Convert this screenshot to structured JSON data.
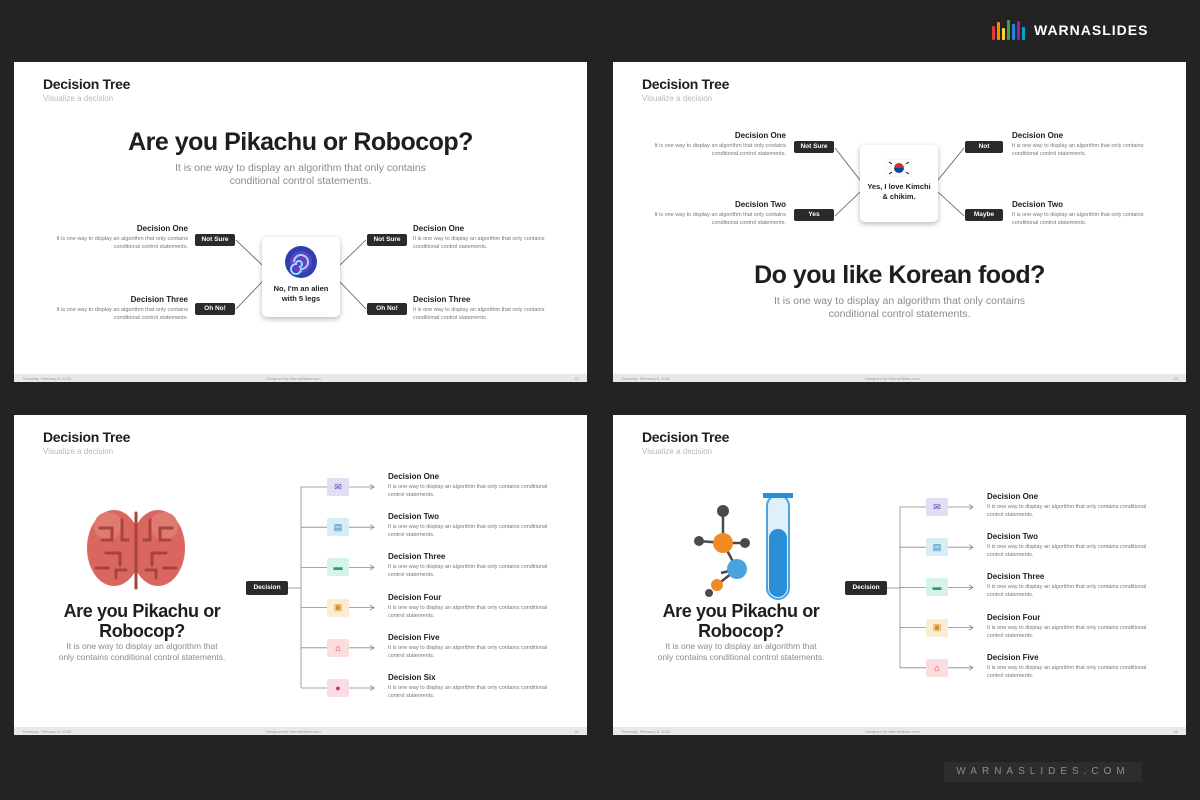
{
  "brand": {
    "name": "WARNASLIDES",
    "bar_colors": [
      "#e53935",
      "#fb8c00",
      "#fdd835",
      "#43a047",
      "#1e88e5",
      "#8e24aa",
      "#00acc1"
    ]
  },
  "watermark": "WARNASLIDES.COM",
  "common": {
    "title": "Decision Tree",
    "subtitle": "Visualize a decision",
    "footer_date": "Thursday, February 6, 2020",
    "footer_design": "Designed by WarnaSlides.com",
    "desc": "It is one way to display an algorithm that only contains conditional control statements."
  },
  "slide1": {
    "question": "Are you Pikachu or Robocop?",
    "description": "It is one way to display an algorithm that only contains conditional control statements.",
    "center_text": "No, I'm an alien with 5 legs",
    "left_top": {
      "title": "Decision One",
      "pill": "Not Sure"
    },
    "left_bottom": {
      "title": "Decision Three",
      "pill": "Oh No!"
    },
    "right_top": {
      "title": "Decision One",
      "pill": "Not Sure"
    },
    "right_bottom": {
      "title": "Decision Three",
      "pill": "Oh No!"
    },
    "page": "42"
  },
  "slide2": {
    "question": "Do you like Korean food?",
    "description": "It is one way to display an algorithm that only contains conditional control statements.",
    "center_text": "Yes, I love Kimchi & chikim.",
    "left_top": {
      "title": "Decision One",
      "pill": "Not Sure"
    },
    "left_bottom": {
      "title": "Decision Two",
      "pill": "Yes"
    },
    "right_top": {
      "title": "Decision One",
      "pill": "Not"
    },
    "right_bottom": {
      "title": "Decision Two",
      "pill": "Maybe"
    },
    "page": "43"
  },
  "slide3": {
    "question_line1": "Are you Pikachu or",
    "question_line2": "Robocop?",
    "description": "It is one way to display an algorithm that only contains conditional control statements.",
    "root": "Decision",
    "items": [
      {
        "title": "Decision One",
        "color": "#e3dcf5",
        "fg": "#5a3fb8"
      },
      {
        "title": "Decision Two",
        "color": "#d6ecf7",
        "fg": "#2a7fb4"
      },
      {
        "title": "Decision Three",
        "color": "#d5f3e7",
        "fg": "#2e9c6e"
      },
      {
        "title": "Decision Four",
        "color": "#fbecd4",
        "fg": "#d98a1e"
      },
      {
        "title": "Decision Five",
        "color": "#fbdcdf",
        "fg": "#d0343f"
      },
      {
        "title": "Decision Six",
        "color": "#fadce4",
        "fg": "#c03a62"
      }
    ],
    "page": "44"
  },
  "slide4": {
    "question_line1": "Are you Pikachu or",
    "question_line2": "Robocop?",
    "description": "It is one way to display an algorithm that only contains conditional control statements.",
    "root": "Decision",
    "items": [
      {
        "title": "Decision One",
        "color": "#e3dcf5",
        "fg": "#5a3fb8"
      },
      {
        "title": "Decision Two",
        "color": "#d6ecf7",
        "fg": "#2a7fb4"
      },
      {
        "title": "Decision Three",
        "color": "#d5f3e7",
        "fg": "#2e9c6e"
      },
      {
        "title": "Decision Four",
        "color": "#fbecd4",
        "fg": "#d98a1e"
      },
      {
        "title": "Decision Five",
        "color": "#fbdcdf",
        "fg": "#d0343f"
      }
    ],
    "page": "45"
  }
}
